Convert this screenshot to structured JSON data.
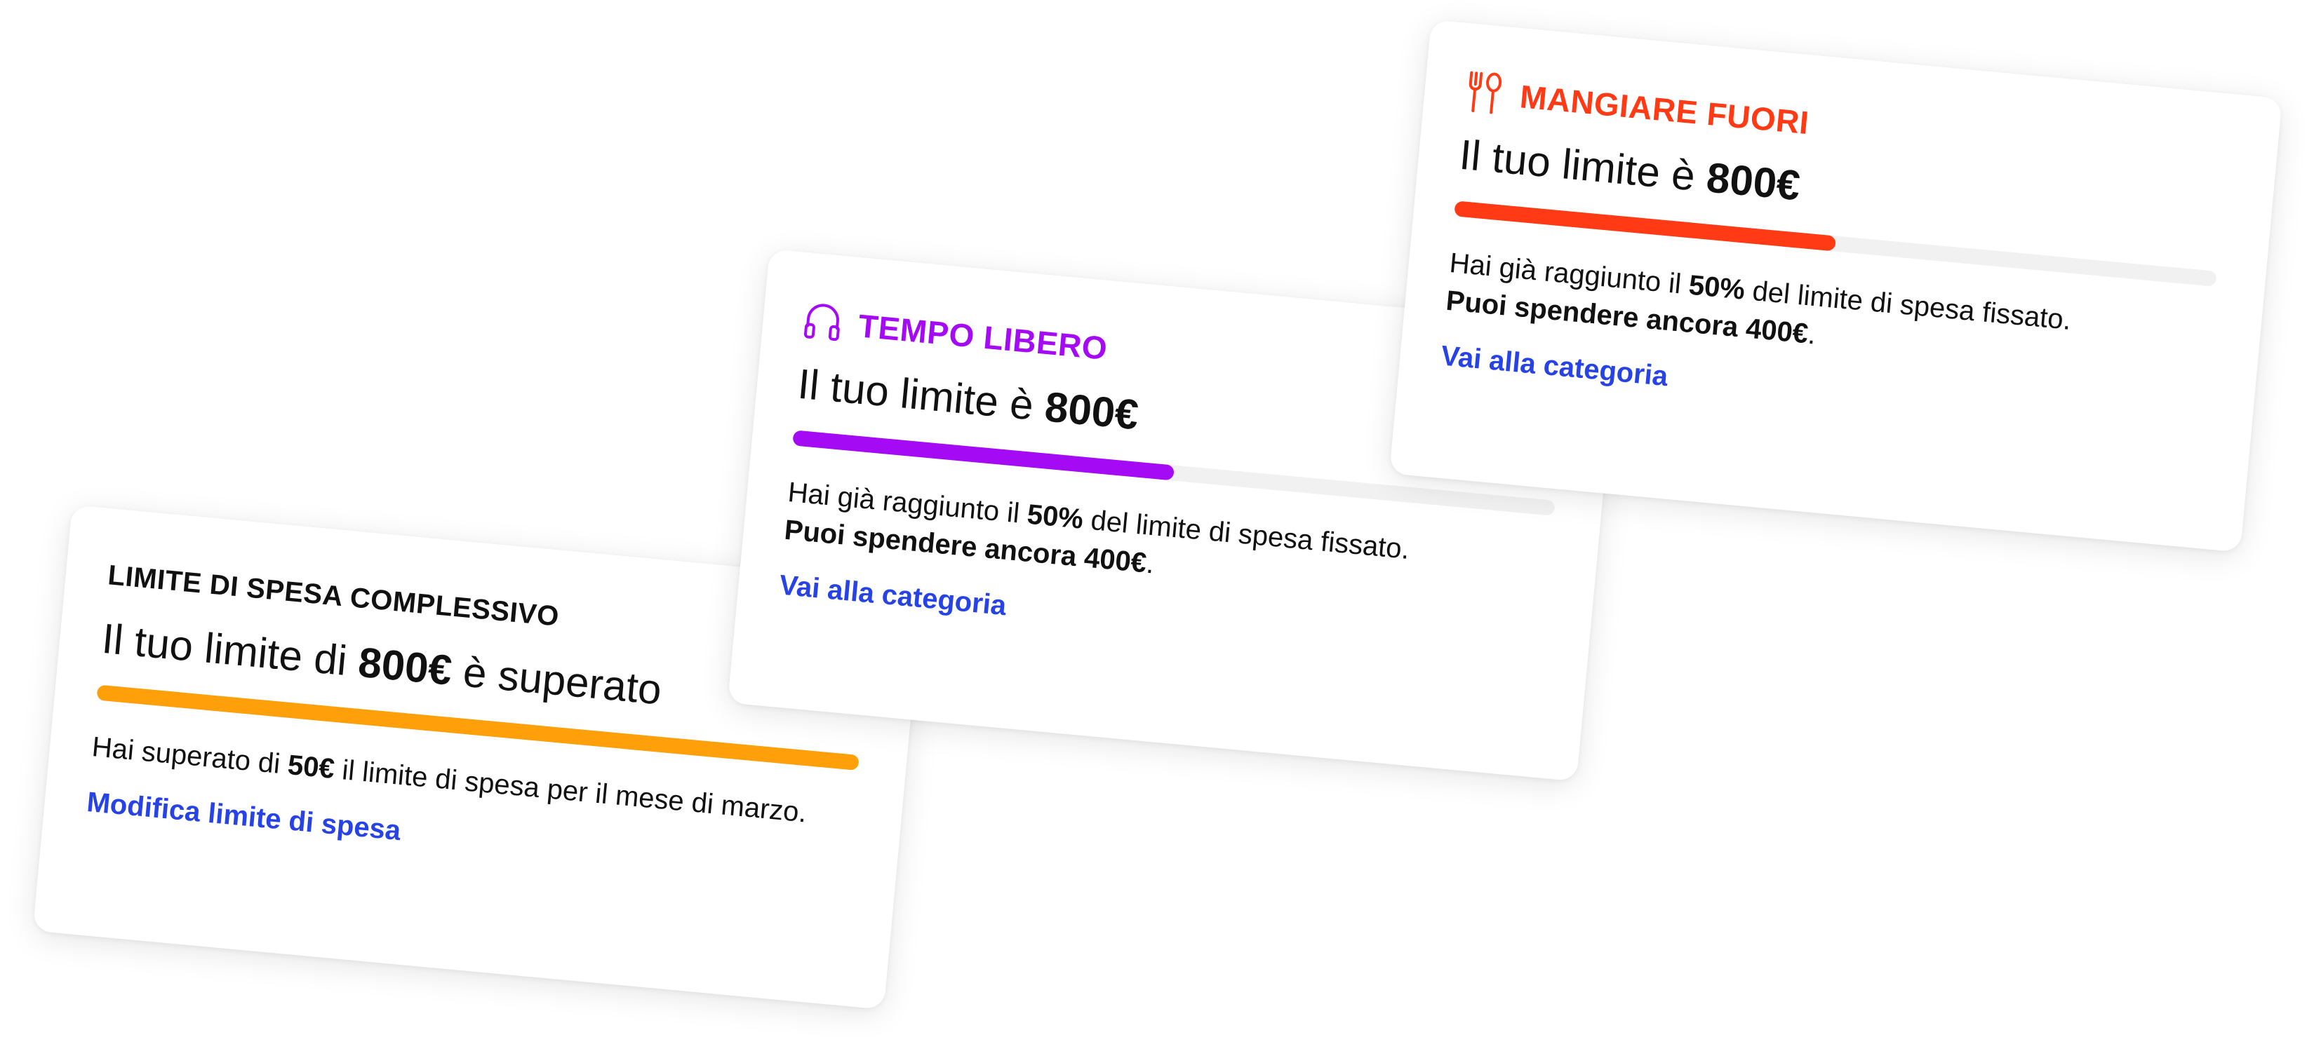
{
  "colors": {
    "link": "#2742e5",
    "complessivo_accent": "#ff9f0a",
    "tempo_libero_accent": "#a50af5",
    "mangiare_fuori_accent": "#ff3a14",
    "bar_track": "#f1f1f1"
  },
  "cards": {
    "complessivo": {
      "title": "LIMITE DI SPESA COMPLESSIVO",
      "limit_prefix": "Il tuo limite di ",
      "limit_amount": "800€",
      "limit_suffix": " è superato",
      "progress_fraction": 1.0,
      "desc_part1": "Hai superato di ",
      "desc_bold1": "50€",
      "desc_part2": " il limite di spesa per il mese di marzo.",
      "link": "Modifica limite di spesa"
    },
    "tempo_libero": {
      "icon": "headphones-icon",
      "title": "TEMPO LIBERO",
      "limit_prefix": "Il tuo limite è ",
      "limit_amount": "800€",
      "progress_fraction": 0.5,
      "desc_part1": "Hai già raggiunto il ",
      "desc_bold1": "50%",
      "desc_part2": " del limite di spesa fissato.",
      "desc_bold2": "Puoi spendere ancora 400€",
      "desc_end": ".",
      "link": "Vai alla categoria"
    },
    "mangiare_fuori": {
      "icon": "fork-spoon-icon",
      "title": "MANGIARE FUORI",
      "limit_prefix": "Il tuo limite è ",
      "limit_amount": "800€",
      "progress_fraction": 0.5,
      "desc_part1": "Hai già raggiunto il ",
      "desc_bold1": "50%",
      "desc_part2": " del limite di spesa fissato.",
      "desc_bold2": "Puoi spendere ancora 400€",
      "desc_end": ".",
      "link": "Vai alla categoria"
    }
  }
}
